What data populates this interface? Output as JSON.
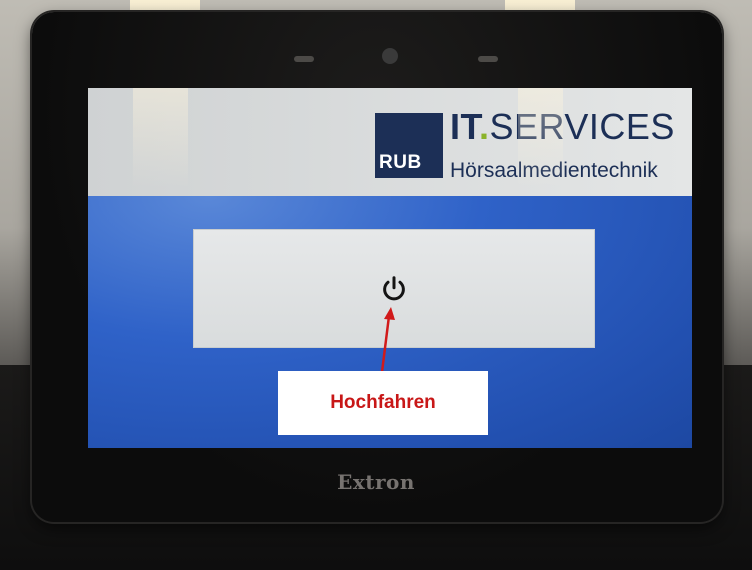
{
  "header": {
    "logo_mark": "RUB",
    "title_prefix": "IT",
    "title_dot": ".",
    "title_rest": "SERVICES",
    "subtitle": "Hörsaalmedientechnik"
  },
  "main": {
    "power_icon": "power-icon"
  },
  "callout": {
    "label": "Hochfahren",
    "color": "#c81717"
  },
  "device": {
    "brand": "Extron"
  },
  "colors": {
    "logo_navy": "#1c2f56",
    "logo_accent": "#8bb32a",
    "screen_blue": "#2f62c8"
  }
}
